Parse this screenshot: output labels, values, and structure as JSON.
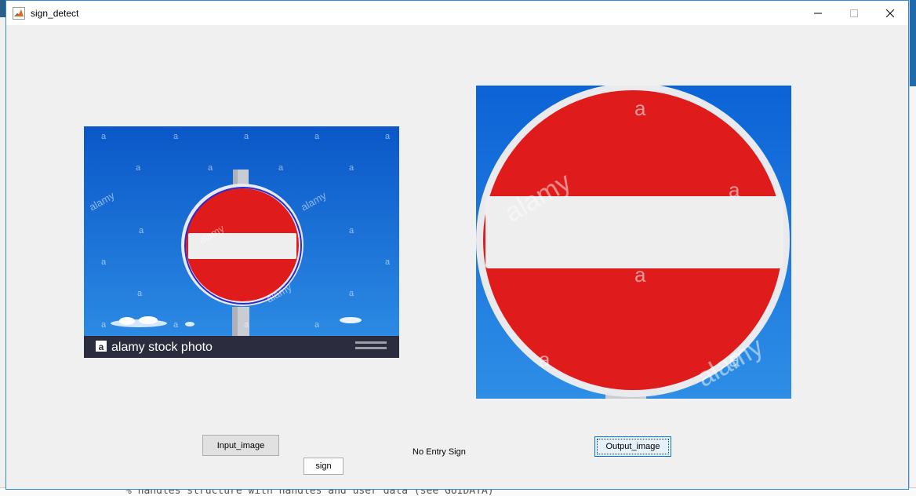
{
  "window": {
    "title": "sign_detect"
  },
  "panels": {
    "input": {
      "watermark_caption": "alamy stock photo",
      "watermark_letter": "a",
      "watermark_word": "alamy"
    },
    "output": {
      "watermark_letter": "a",
      "watermark_word": "alamy"
    }
  },
  "buttons": {
    "input_image": "Input_image",
    "sign": "sign",
    "output_image": "Output_image"
  },
  "result": {
    "label": "No Entry Sign"
  },
  "background": {
    "code_fragment": "% handles    structure with handles and user data (see GUIDATA)"
  },
  "colors": {
    "window_border": "#2f8ad8",
    "sign_red": "#e01b1b",
    "sky_blue": "#1f74d6",
    "detection_circle": "#2a2ad0"
  }
}
